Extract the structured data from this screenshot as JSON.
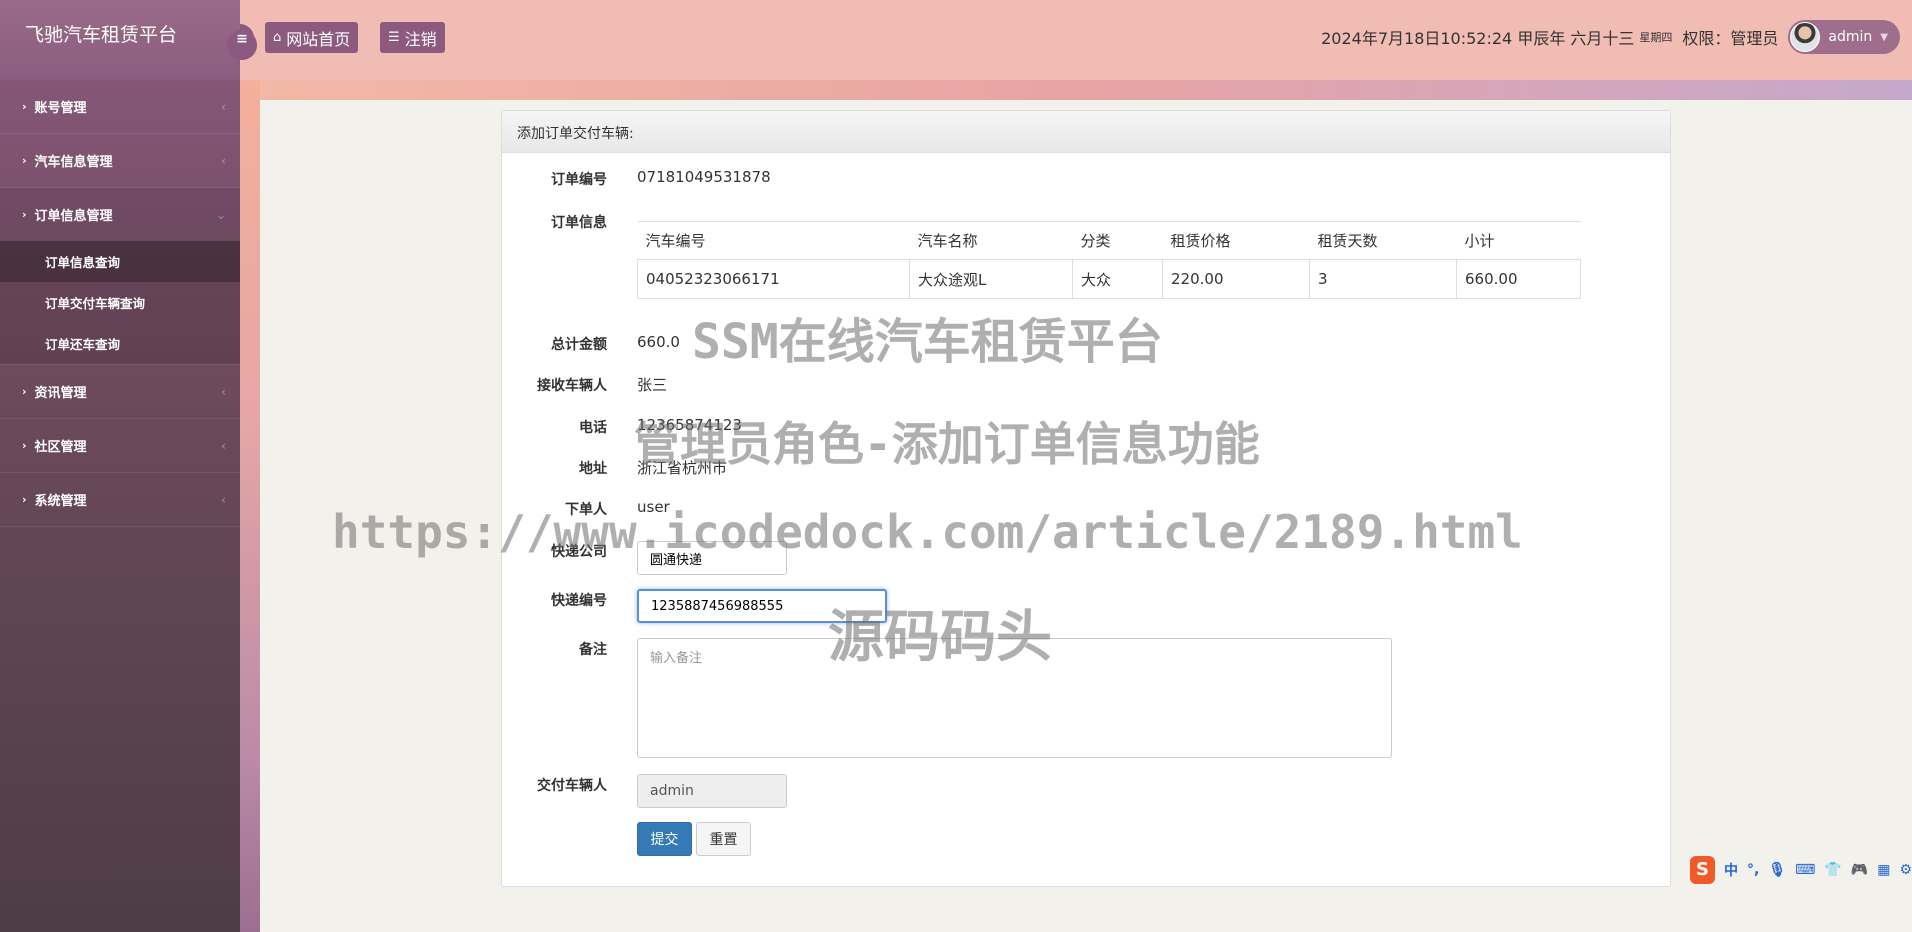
{
  "app": {
    "title": "飞驰汽车租赁平台"
  },
  "header": {
    "home_label": "网站首页",
    "logout_label": "注销",
    "datetime": "2024年7月18日10:52:24 甲辰年 六月十三",
    "weekday": "星期四",
    "role": "权限：管理员",
    "username": "admin"
  },
  "sidebar": {
    "items": [
      {
        "label": "账号管理"
      },
      {
        "label": "汽车信息管理"
      },
      {
        "label": "订单信息管理",
        "children": [
          "订单信息查询",
          "订单交付车辆查询",
          "订单还车查询"
        ]
      },
      {
        "label": "资讯管理"
      },
      {
        "label": "社区管理"
      },
      {
        "label": "系统管理"
      }
    ]
  },
  "form": {
    "title": "添加订单交付车辆:",
    "order_no_label": "订单编号",
    "order_no": "07181049531878",
    "order_info_label": "订单信息",
    "table": {
      "headers": [
        "汽车编号",
        "汽车名称",
        "分类",
        "租赁价格",
        "租赁天数",
        "小计"
      ],
      "rows": [
        [
          "04052323066171",
          "大众途观L",
          "大众",
          "220.00",
          "3",
          "660.00"
        ]
      ]
    },
    "total_label": "总计金额",
    "total": "660.0",
    "receiver_label": "接收车辆人",
    "receiver": "张三",
    "phone_label": "电话",
    "phone": "12365874123",
    "address_label": "地址",
    "address": "浙江省杭州市",
    "orderer_label": "下单人",
    "orderer": "user",
    "courier_label": "快递公司",
    "courier": "圆通快递",
    "tracking_label": "快递编号",
    "tracking": "1235887456988555",
    "remark_label": "备注",
    "remark_placeholder": "输入备注",
    "deliverer_label": "交付车辆人",
    "deliverer": "admin",
    "submit_label": "提交",
    "reset_label": "重置"
  },
  "watermarks": {
    "line1": "SSM在线汽车租赁平台",
    "line2": "管理员角色-添加订单信息功能",
    "line3": "https://www.icodedock.com/article/2189.html",
    "line4": "源码码头"
  },
  "ime": {
    "mode": "中"
  }
}
